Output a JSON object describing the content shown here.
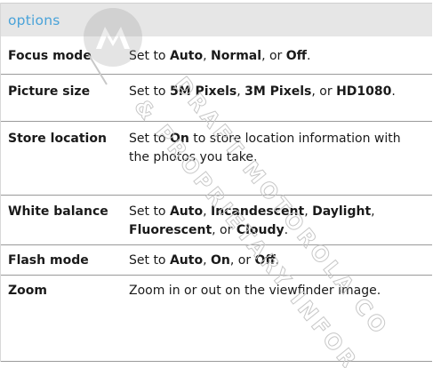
{
  "header": {
    "title": "options"
  },
  "rows": [
    {
      "name": "Focus mode",
      "desc": [
        {
          "t": "Set to ",
          "b": false
        },
        {
          "t": "Auto",
          "b": true
        },
        {
          "t": ", ",
          "b": false
        },
        {
          "t": "Normal",
          "b": true
        },
        {
          "t": ", or ",
          "b": false
        },
        {
          "t": "Off",
          "b": true
        },
        {
          "t": ".",
          "b": false
        }
      ]
    },
    {
      "name": "Picture size",
      "desc": [
        {
          "t": "Set to ",
          "b": false
        },
        {
          "t": "5M Pixels",
          "b": true
        },
        {
          "t": ", ",
          "b": false
        },
        {
          "t": "3M Pixels",
          "b": true
        },
        {
          "t": ", or ",
          "b": false
        },
        {
          "t": "HD1080",
          "b": true
        },
        {
          "t": ".",
          "b": false
        }
      ]
    },
    {
      "name": "Store location",
      "desc": [
        {
          "t": "Set to ",
          "b": false
        },
        {
          "t": "On",
          "b": true
        },
        {
          "t": " to store location information with the photos you take.",
          "b": false
        }
      ]
    },
    {
      "name": "White balance",
      "desc": [
        {
          "t": "Set to ",
          "b": false
        },
        {
          "t": "Auto",
          "b": true
        },
        {
          "t": ", ",
          "b": false
        },
        {
          "t": "Incandescent",
          "b": true
        },
        {
          "t": ", ",
          "b": false
        },
        {
          "t": "Daylight",
          "b": true
        },
        {
          "t": ", ",
          "b": false
        },
        {
          "t": "Fluorescent",
          "b": true
        },
        {
          "t": ", or ",
          "b": false
        },
        {
          "t": "Cloudy",
          "b": true
        },
        {
          "t": ".",
          "b": false
        }
      ]
    },
    {
      "name": "Flash mode",
      "desc": [
        {
          "t": "Set to ",
          "b": false
        },
        {
          "t": "Auto",
          "b": true
        },
        {
          "t": ", ",
          "b": false
        },
        {
          "t": "On",
          "b": true
        },
        {
          "t": ", or ",
          "b": false
        },
        {
          "t": "Off",
          "b": true
        },
        {
          "t": ".",
          "b": false
        }
      ]
    },
    {
      "name": "Zoom",
      "desc": [
        {
          "t": "Zoom in or out on the viewfinder image.",
          "b": false
        }
      ]
    }
  ],
  "watermark": {
    "lines": [
      "DRAFT MOTOROLA CO",
      "& PROPRIETARY INFOR"
    ],
    "color": "#c8c8c8"
  },
  "colors": {
    "header_text": "#4aa3d9",
    "header_bg": "#e6e6e6",
    "rule": "#9a9a9a"
  }
}
